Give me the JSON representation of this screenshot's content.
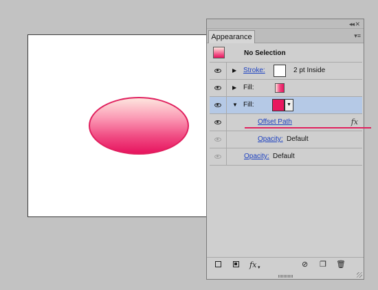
{
  "panel": {
    "tab_label": "Appearance",
    "header": {
      "selection_label": "No Selection"
    },
    "rows": [
      {
        "label": "Stroke:",
        "value": "2 pt  Inside"
      },
      {
        "label": "Fill:"
      },
      {
        "label": "Fill:"
      },
      {
        "label": "Offset Path",
        "effect_icon": "fx"
      },
      {
        "label": "Opacity:",
        "value": "Default"
      },
      {
        "label": "Opacity:",
        "value": "Default"
      }
    ],
    "bottom_bar": {
      "fx_label": "fx"
    }
  },
  "colors": {
    "fill_color": "#e8175f",
    "selected_row": "#b5c9e6",
    "link_color": "#1a3fc0"
  }
}
